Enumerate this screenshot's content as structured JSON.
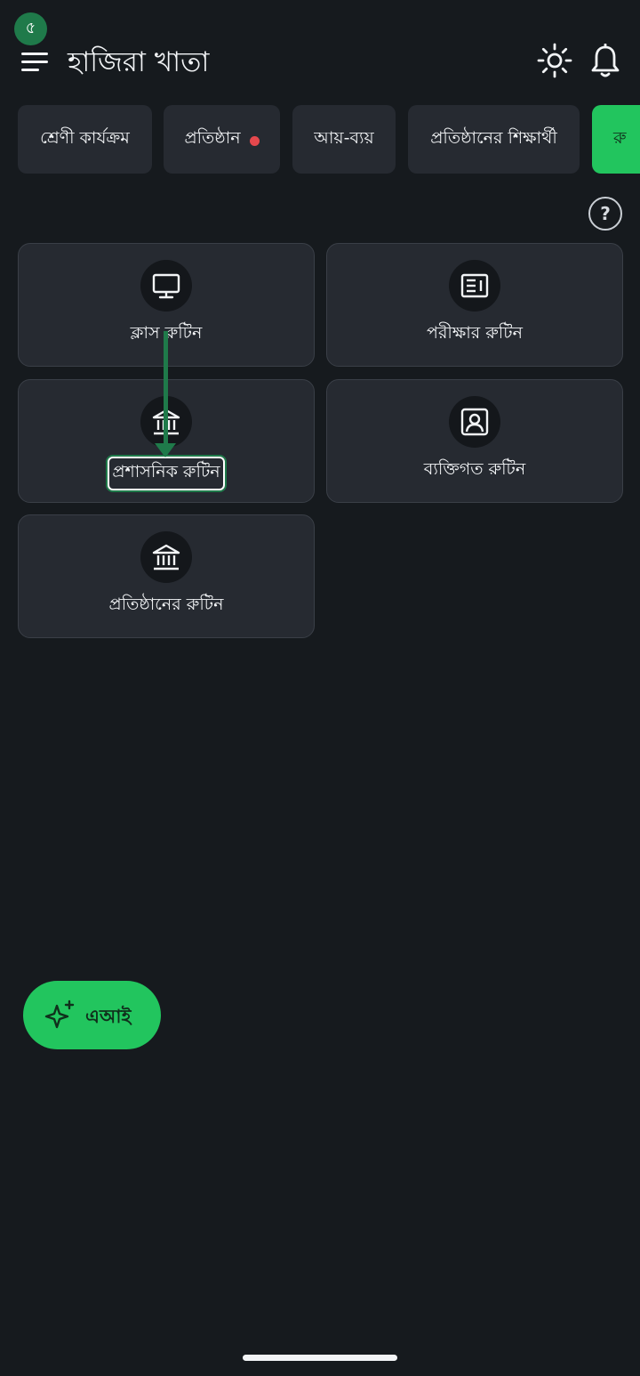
{
  "step_badge": "৫",
  "header": {
    "title": "হাজিরা খাতা",
    "icons": [
      "menu-icon",
      "sun-icon",
      "bell-icon"
    ]
  },
  "chips": [
    {
      "label": "শ্রেণী কার্যক্রম",
      "dot": false
    },
    {
      "label": "প্রতিষ্ঠান",
      "dot": true
    },
    {
      "label": "আয়-ব্যয়",
      "dot": false
    },
    {
      "label": "প্রতিষ্ঠানের শিক্ষার্থী",
      "dot": false
    },
    {
      "label": "রু",
      "active": true
    }
  ],
  "help_label": "?",
  "cards": [
    {
      "label": "ক্লাস রুটিন",
      "icon": "monitor-icon"
    },
    {
      "label": "পরীক্ষার রুটিন",
      "icon": "newspaper-icon"
    },
    {
      "label": "প্রশাসনিক রুটিন",
      "icon": "bank-icon",
      "highlighted": true
    },
    {
      "label": "ব্যক্তিগত রুটিন",
      "icon": "user-square-icon"
    },
    {
      "label": "প্রতিষ্ঠানের রুটিন",
      "icon": "bank-icon"
    }
  ],
  "ai_button": {
    "label": "এআই",
    "icon": "sparkle-icon"
  },
  "colors": {
    "background": "#161a1e",
    "card": "#262a31",
    "accent_green": "#22c55e",
    "annotation_green": "#1f7a4a",
    "notification_dot": "#e5484d"
  }
}
